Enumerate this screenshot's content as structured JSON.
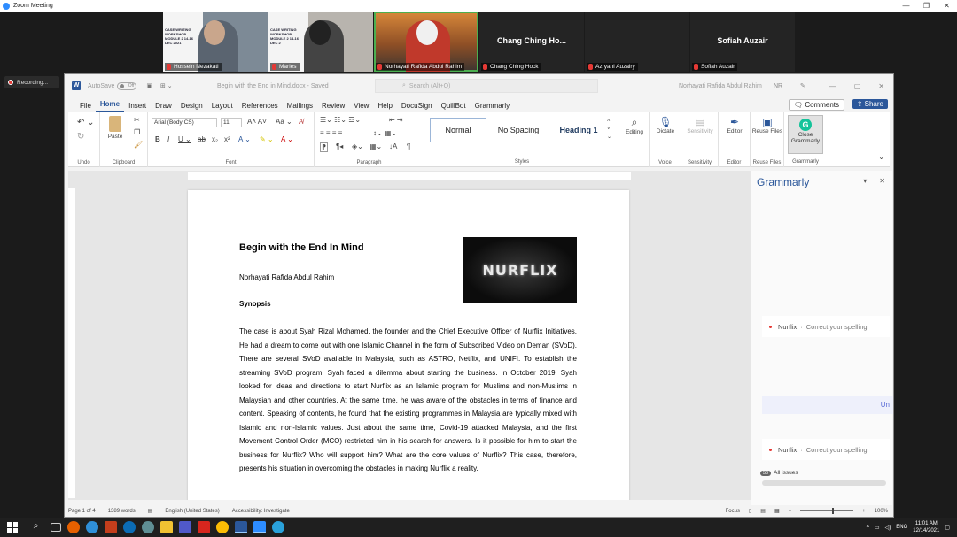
{
  "zoom": {
    "title": "Zoom Meeting",
    "recording_label": "Recording...",
    "participants": [
      {
        "name": "Hossein Nezakati",
        "slide_text": "CASE WRITING WORKSHOP MODULE 2 14-16 DEC 2021",
        "video": true
      },
      {
        "name": "Maries",
        "slide_text": "CASE WRITING WORKSHOP MODULE 2 14-16 DEC 2",
        "video": true
      },
      {
        "name": "Norhayati Rafida Abdul Rahim",
        "video": true,
        "speaking": true
      },
      {
        "name": "Chang Ching Hock",
        "display": "Chang Ching Ho...",
        "video": false
      },
      {
        "name": "Azryani Auzairy",
        "display": "",
        "video": false
      },
      {
        "name": "Sofiah Auzair",
        "display": "Sofiah Auzair",
        "video": false
      }
    ]
  },
  "word": {
    "autosave_label": "AutoSave",
    "autosave_state": "Off",
    "doc_title": "Begin with the End in Mind.docx - Saved",
    "search_placeholder": "Search (Alt+Q)",
    "user": "Norhayati Rafida Abdul Rahim",
    "user_initials": "NR",
    "tabs": [
      "File",
      "Home",
      "Insert",
      "Draw",
      "Design",
      "Layout",
      "References",
      "Mailings",
      "Review",
      "View",
      "Help",
      "DocuSign",
      "QuillBot",
      "Grammarly"
    ],
    "active_tab": "Home",
    "comments_label": "Comments",
    "share_label": "Share",
    "ribbon": {
      "undo_label": "Undo",
      "clipboard_label": "Clipboard",
      "paste_label": "Paste",
      "font_label": "Font",
      "font_name": "Arial (Body CS)",
      "font_size": "11",
      "paragraph_label": "Paragraph",
      "styles_label": "Styles",
      "styles": [
        "Normal",
        "No Spacing",
        "Heading 1"
      ],
      "editing_label": "Editing",
      "dictate_label": "Dictate",
      "voice_label": "Voice",
      "sensitivity_label": "Sensitivity",
      "editor_label": "Editor",
      "reuse_files_label": "Reuse Files",
      "close_grammarly_label": "Close Grammarly",
      "grammarly_label": "Grammarly"
    },
    "document": {
      "title": "Begin with the End In Mind",
      "author": "Norhayati Rafida Abdul Rahim",
      "section": "Synopsis",
      "logo_text": "NURFLIX",
      "body": "The case is about Syah Rizal Mohamed, the founder and the Chief Executive Officer of Nurflix Initiatives. He had a dream to come out with one Islamic Channel in the form of Subscribed Video on Deman (SVoD). There are several SVoD available in Malaysia, such as ASTRO, Netflix, and UNIFI. To establish the streaming SVoD program, Syah faced a dilemma about starting the business.  In October 2019, Syah looked for ideas and directions to start Nurflix as an Islamic program for Muslims and non-Muslims in Malaysian and other countries. At the same time, he was aware of the obstacles in terms of finance and content.  Speaking of contents, he found that the existing programmes in Malaysia are typically mixed with Islamic and non-Islamic values. Just about the same time, Covid-19 attacked Malaysia, and the first Movement Control Order (MCO) restricted him in his search for answers.  Is it possible for him to start the business for Nurflix? Who will support him? What are the core values of Nurflix? This case, therefore, presents his situation in overcoming the obstacles in making Nurflix a reality."
    },
    "grammarly": {
      "title": "Grammarly",
      "cards": [
        {
          "word": "Nurflix",
          "sep": "·",
          "action": "Correct your spelling"
        },
        {
          "word": "Nurflix",
          "sep": "·",
          "action": "Correct your spelling"
        }
      ],
      "partial_text": "Un",
      "issues_count": "50",
      "all_issues_label": "All issues"
    },
    "status": {
      "page": "Page 1 of 4",
      "words": "1389 words",
      "language": "English (United States)",
      "accessibility": "Accessibility: Investigate",
      "focus": "Focus",
      "zoom": "100%"
    }
  },
  "taskbar": {
    "time": "11:01 AM",
    "date": "12/14/2021",
    "lang": "ENG"
  },
  "colors": {
    "word_blue": "#2b579a",
    "grammarly_green": "#15c39a",
    "zoom_blue": "#2d8cff"
  }
}
